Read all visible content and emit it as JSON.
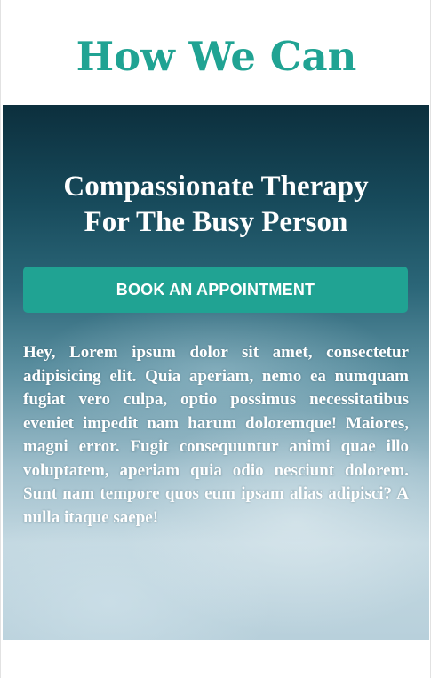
{
  "header": {
    "title": "How We Can"
  },
  "hero": {
    "heading_line1": "Compassionate Therapy",
    "heading_line2": "For The Busy Person",
    "cta_label": "BOOK AN APPOINTMENT",
    "body": "Hey, Lorem ipsum dolor sit amet, consectetur adipisicing elit. Quia aperiam, nemo ea numquam fugiat vero culpa, optio possimus necessitatibus eveniet impedit nam harum doloremque! Maiores, magni error. Fugit consequuntur animi quae illo voluptatem, aperiam quia odio nesciunt dolorem. Sunt nam tempore quos eum ipsam alias adipisci? A nulla itaque saepe!"
  },
  "colors": {
    "accent": "#20a393",
    "text_on_hero": "#ffffff",
    "page_background": "#ffffff"
  },
  "background_image": "ocean-waves-aerial"
}
